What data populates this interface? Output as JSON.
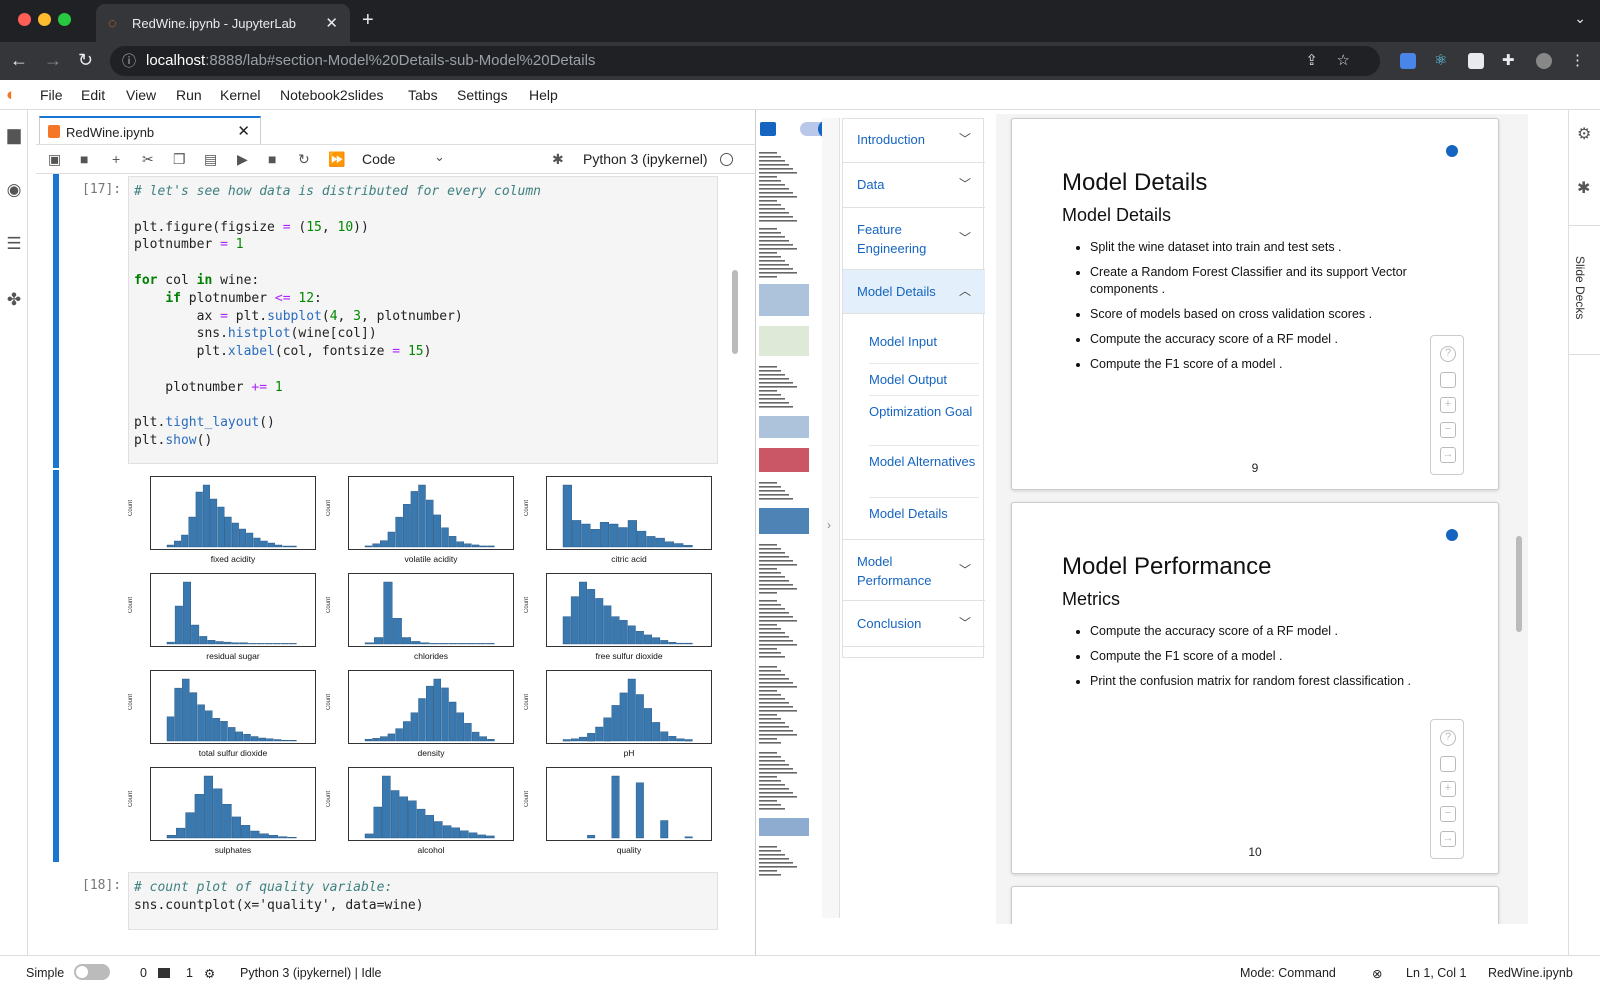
{
  "browser": {
    "tab_title": "RedWine.ipynb - JupyterLab",
    "url_host": "localhost",
    "url_rest": ":8888/lab#section-Model%20Details-sub-Model%20Details"
  },
  "menu": [
    "File",
    "Edit",
    "View",
    "Run",
    "Kernel",
    "Notebook2slides",
    "Tabs",
    "Settings",
    "Help"
  ],
  "notebook": {
    "tab_name": "RedWine.ipynb",
    "cell_type": "Code",
    "kernel": "Python 3 (ipykernel)",
    "cell17_prompt": "[17]:",
    "cell18_prompt": "[18]:",
    "cell18_comment": "# count plot of quality variable:",
    "cell18_code": "sns.countplot(x='quality', data=wine)"
  },
  "plots": [
    {
      "xlabel": "fixed acidity",
      "ylabel": "Count"
    },
    {
      "xlabel": "volatile acidity",
      "ylabel": "Count"
    },
    {
      "xlabel": "citric acid",
      "ylabel": "Count"
    },
    {
      "xlabel": "residual sugar",
      "ylabel": "Count"
    },
    {
      "xlabel": "chlorides",
      "ylabel": "Count"
    },
    {
      "xlabel": "free sulfur dioxide",
      "ylabel": "Count"
    },
    {
      "xlabel": "total sulfur dioxide",
      "ylabel": "Count"
    },
    {
      "xlabel": "density",
      "ylabel": "Count"
    },
    {
      "xlabel": "pH",
      "ylabel": "Count"
    },
    {
      "xlabel": "sulphates",
      "ylabel": "Count"
    },
    {
      "xlabel": "alcohol",
      "ylabel": "Count"
    },
    {
      "xlabel": "quality",
      "ylabel": "Count"
    }
  ],
  "toc": {
    "sections": [
      {
        "label": "Introduction"
      },
      {
        "label": "Data"
      },
      {
        "label": "Feature Engineering"
      },
      {
        "label": "Model Details"
      },
      {
        "label": "Model Performance"
      },
      {
        "label": "Conclusion"
      }
    ],
    "subsections": [
      "Model Input",
      "Model Output",
      "Optimization Goal",
      "Model Alternatives",
      "Model Details"
    ]
  },
  "slides": [
    {
      "title": "Model Details",
      "subtitle": "Model Details",
      "bullets": [
        "Split the wine dataset into train and test sets .",
        "Create a Random Forest Classifier and its support Vector components .",
        "Score of models based on cross validation scores .",
        "Compute the accuracy score of a RF model .",
        "Compute the F1 score of a model ."
      ],
      "number": "9"
    },
    {
      "title": "Model Performance",
      "subtitle": "Metrics",
      "bullets": [
        "Compute the accuracy score of a RF model .",
        "Compute the F1 score of a model .",
        "Print the confusion matrix for random forest classification ."
      ],
      "number": "10"
    }
  ],
  "right_sidebar": {
    "slide_decks": "Slide Decks"
  },
  "status": {
    "mode_label": "Simple",
    "terminals": "0",
    "kernels": "1",
    "kernel_status": "Python 3 (ipykernel) | Idle",
    "mode": "Mode: Command",
    "position": "Ln 1, Col 1",
    "file": "RedWine.ipynb"
  }
}
